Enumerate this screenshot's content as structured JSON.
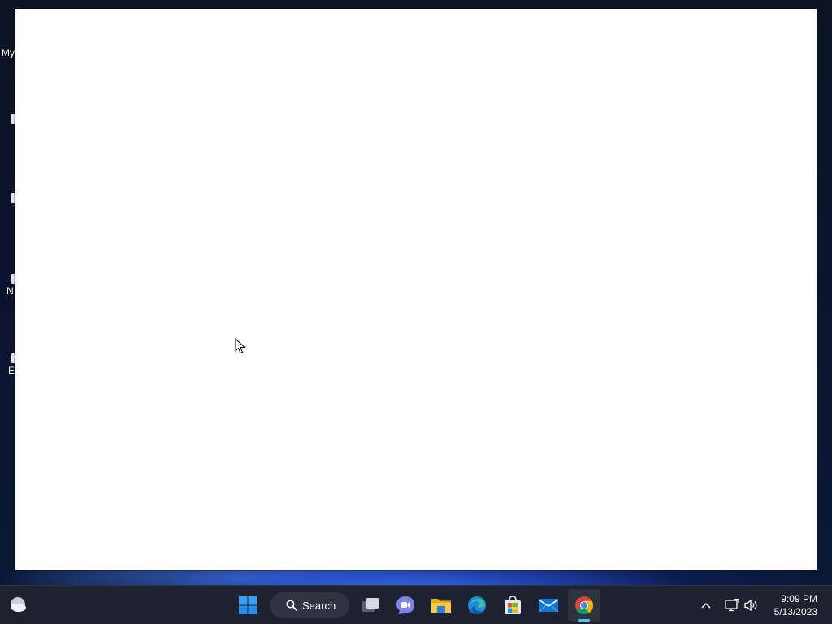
{
  "desktop": {
    "icons": [
      {
        "name": "this-pc",
        "label": "My"
      },
      {
        "name": "item-2",
        "label": ""
      },
      {
        "name": "item-3",
        "label": ""
      },
      {
        "name": "item-4",
        "label": "N"
      },
      {
        "name": "item-5",
        "label": "E"
      }
    ]
  },
  "taskbar": {
    "search_label": "Search",
    "apps": [
      {
        "name": "start",
        "icon": "windows-logo-icon"
      },
      {
        "name": "task-view",
        "icon": "task-view-icon"
      },
      {
        "name": "teams-chat",
        "icon": "teams-chat-icon"
      },
      {
        "name": "file-explorer",
        "icon": "folder-icon"
      },
      {
        "name": "edge",
        "icon": "edge-icon"
      },
      {
        "name": "store",
        "icon": "store-icon"
      },
      {
        "name": "mail",
        "icon": "mail-icon"
      },
      {
        "name": "chrome",
        "icon": "chrome-icon",
        "active": true
      }
    ],
    "tray": {
      "time": "9:09 PM",
      "date": "5/13/2023"
    }
  },
  "colors": {
    "taskbar_bg": "#1d2230",
    "accent_indicator": "#4cc2ff",
    "window_bg": "#ffffff"
  }
}
